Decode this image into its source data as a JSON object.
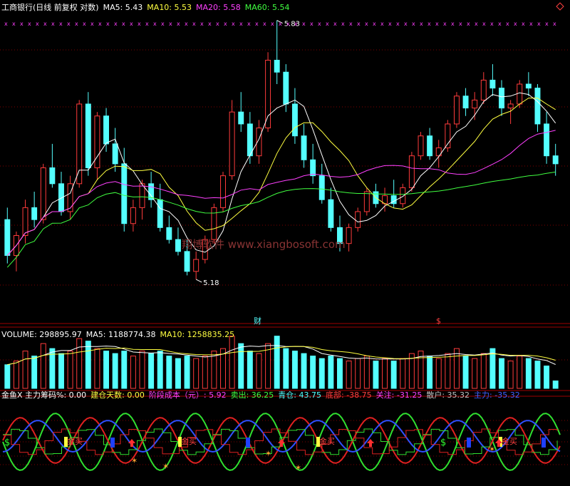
{
  "colors": {
    "background": "#000000",
    "up": "#ff3b3b",
    "down": "#54ffff",
    "ma5": "#ffffff",
    "ma10": "#ffff40",
    "ma20": "#ff40ff",
    "ma60": "#40ff40",
    "grid": "#800000",
    "separator": "#a00000",
    "watermark": "#883333",
    "label": "#ffffff"
  },
  "watermark": "翔博软件 www.xiangbosoft.com",
  "price_panel": {
    "legend": [
      {
        "text": "工商银行(日线 前复权 对数)",
        "color": "#ffffff"
      },
      {
        "text": "MA5: 5.43",
        "color": "#ffffff"
      },
      {
        "text": "MA10: 5.53",
        "color": "#ffff40"
      },
      {
        "text": "MA20: 5.58",
        "color": "#ff40ff"
      },
      {
        "text": "MA60: 5.54",
        "color": "#40ff40"
      }
    ],
    "high_label": "5.83",
    "low_label": "5.18",
    "event_markers": [
      "财",
      "$"
    ],
    "corner_icon": "diamond-icon"
  },
  "volume_panel": {
    "legend": [
      {
        "text": "VOLUME: 298895.97",
        "color": "#ffffff"
      },
      {
        "text": "MA5: 1188774.38",
        "color": "#ffffff"
      },
      {
        "text": "MA10: 1258835.25",
        "color": "#ffff40"
      }
    ]
  },
  "indicator_panel": {
    "legend": [
      {
        "text": "金鱼X 主力筹码%: 0.00",
        "color": "#ffffff"
      },
      {
        "text": "建仓天数: 0.00",
        "color": "#ffff40"
      },
      {
        "text": "阶段成本（元）: 5.92",
        "color": "#ff40ff"
      },
      {
        "text": "卖出: 36.25",
        "color": "#40ff40"
      },
      {
        "text": "青仓: 43.75",
        "color": "#54ffff"
      },
      {
        "text": "底部: -38.75",
        "color": "#ff4040"
      },
      {
        "text": "关注: -31.25",
        "color": "#ff40ff"
      },
      {
        "text": "散户: 35.32",
        "color": "#c0c0c0"
      },
      {
        "text": "主力: -35.32",
        "color": "#4060ff"
      }
    ],
    "buy_label": "金买",
    "dollar_label": "$"
  },
  "chart_data": {
    "type": "candlestick",
    "candles": [
      [
        5.33,
        5.36,
        5.22,
        5.24
      ],
      [
        5.24,
        5.3,
        5.2,
        5.29
      ],
      [
        5.29,
        5.38,
        5.27,
        5.36
      ],
      [
        5.36,
        5.4,
        5.31,
        5.33
      ],
      [
        5.33,
        5.47,
        5.32,
        5.46
      ],
      [
        5.46,
        5.52,
        5.41,
        5.42
      ],
      [
        5.42,
        5.45,
        5.34,
        5.35
      ],
      [
        5.35,
        5.44,
        5.33,
        5.42
      ],
      [
        5.42,
        5.63,
        5.41,
        5.62
      ],
      [
        5.62,
        5.65,
        5.44,
        5.46
      ],
      [
        5.46,
        5.6,
        5.43,
        5.59
      ],
      [
        5.59,
        5.61,
        5.5,
        5.52
      ],
      [
        5.52,
        5.56,
        5.45,
        5.47
      ],
      [
        5.47,
        5.51,
        5.3,
        5.32
      ],
      [
        5.32,
        5.38,
        5.3,
        5.36
      ],
      [
        5.36,
        5.43,
        5.33,
        5.42
      ],
      [
        5.42,
        5.45,
        5.36,
        5.38
      ],
      [
        5.38,
        5.42,
        5.3,
        5.31
      ],
      [
        5.31,
        5.34,
        5.27,
        5.28
      ],
      [
        5.28,
        5.31,
        5.24,
        5.25
      ],
      [
        5.25,
        5.28,
        5.19,
        5.2
      ],
      [
        5.2,
        5.25,
        5.18,
        5.23
      ],
      [
        5.23,
        5.29,
        5.22,
        5.28
      ],
      [
        5.28,
        5.37,
        5.27,
        5.36
      ],
      [
        5.36,
        5.45,
        5.35,
        5.44
      ],
      [
        5.44,
        5.63,
        5.43,
        5.6
      ],
      [
        5.6,
        5.65,
        5.55,
        5.57
      ],
      [
        5.57,
        5.6,
        5.47,
        5.49
      ],
      [
        5.49,
        5.58,
        5.47,
        5.56
      ],
      [
        5.56,
        5.75,
        5.55,
        5.73
      ],
      [
        5.73,
        5.83,
        5.67,
        5.7
      ],
      [
        5.7,
        5.72,
        5.6,
        5.62
      ],
      [
        5.62,
        5.66,
        5.52,
        5.54
      ],
      [
        5.54,
        5.57,
        5.46,
        5.48
      ],
      [
        5.48,
        5.52,
        5.42,
        5.44
      ],
      [
        5.44,
        5.47,
        5.37,
        5.38
      ],
      [
        5.38,
        5.41,
        5.3,
        5.31
      ],
      [
        5.31,
        5.34,
        5.25,
        5.27
      ],
      [
        5.27,
        5.32,
        5.25,
        5.31
      ],
      [
        5.31,
        5.36,
        5.3,
        5.35
      ],
      [
        5.35,
        5.41,
        5.34,
        5.4
      ],
      [
        5.4,
        5.42,
        5.36,
        5.37
      ],
      [
        5.37,
        5.41,
        5.35,
        5.39
      ],
      [
        5.39,
        5.43,
        5.36,
        5.37
      ],
      [
        5.37,
        5.42,
        5.36,
        5.41
      ],
      [
        5.41,
        5.5,
        5.4,
        5.49
      ],
      [
        5.49,
        5.55,
        5.48,
        5.54
      ],
      [
        5.54,
        5.56,
        5.48,
        5.49
      ],
      [
        5.49,
        5.53,
        5.46,
        5.51
      ],
      [
        5.51,
        5.58,
        5.5,
        5.57
      ],
      [
        5.57,
        5.65,
        5.56,
        5.64
      ],
      [
        5.64,
        5.66,
        5.59,
        5.61
      ],
      [
        5.61,
        5.65,
        5.58,
        5.63
      ],
      [
        5.63,
        5.7,
        5.62,
        5.68
      ],
      [
        5.68,
        5.72,
        5.64,
        5.66
      ],
      [
        5.66,
        5.68,
        5.59,
        5.61
      ],
      [
        5.61,
        5.63,
        5.57,
        5.62
      ],
      [
        5.62,
        5.68,
        5.61,
        5.67
      ],
      [
        5.67,
        5.7,
        5.64,
        5.66
      ],
      [
        5.66,
        5.67,
        5.55,
        5.57
      ],
      [
        5.57,
        5.6,
        5.47,
        5.49
      ],
      [
        5.49,
        5.52,
        5.44,
        5.47
      ]
    ],
    "volume": [
      0.95,
      1.1,
      1.5,
      1.3,
      1.8,
      1.6,
      1.4,
      1.5,
      2.0,
      1.9,
      1.6,
      1.5,
      1.4,
      1.5,
      1.3,
      1.5,
      1.4,
      1.5,
      1.3,
      1.2,
      1.3,
      1.2,
      1.3,
      1.5,
      1.6,
      2.1,
      1.8,
      1.5,
      1.4,
      1.8,
      2.1,
      1.6,
      1.5,
      1.4,
      1.3,
      1.2,
      1.3,
      1.2,
      1.1,
      1.2,
      1.3,
      1.1,
      1.2,
      1.1,
      1.2,
      1.4,
      1.5,
      1.3,
      1.2,
      1.4,
      1.6,
      1.3,
      1.2,
      1.4,
      1.6,
      1.2,
      1.1,
      1.3,
      1.2,
      1.1,
      0.9,
      0.3
    ]
  }
}
